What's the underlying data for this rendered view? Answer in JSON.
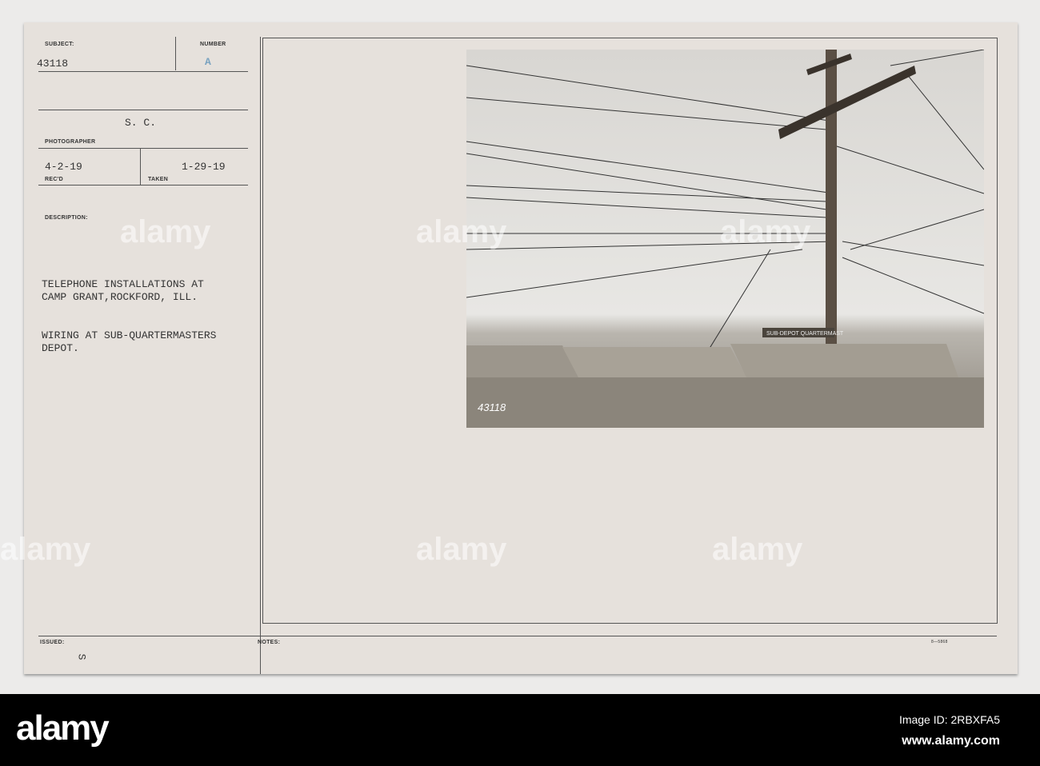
{
  "card": {
    "subject_label": "SUBJECT:",
    "subject_value": "43118",
    "number_label": "NUMBER",
    "number_value": "A",
    "photographer_value": "S. C.",
    "photographer_label": "PHOTOGRAPHER",
    "recd_value": "4-2-19",
    "recd_label": "REC'D",
    "taken_value": "1-29-19",
    "taken_label": "TAKEN",
    "description_label": "DESCRIPTION:",
    "description_line1": "TELEPHONE INSTALLATIONS AT",
    "description_line2": "CAMP GRANT,ROCKFORD, ILL.",
    "description_line3": "WIRING AT SUB-QUARTERMASTERS",
    "description_line4": "DEPOT.",
    "issued_label": "ISSUED:",
    "issued_value": "S",
    "notes_label": "NOTES:",
    "form_code": "8—5868"
  },
  "photo": {
    "negative_number": "43118",
    "sign_text": "SUB-DEPOT QUARTERMAST"
  },
  "watermark": "alamy",
  "footer": {
    "logo": "alamy",
    "image_id": "Image ID: 2RBXFA5",
    "url": "www.alamy.com"
  }
}
